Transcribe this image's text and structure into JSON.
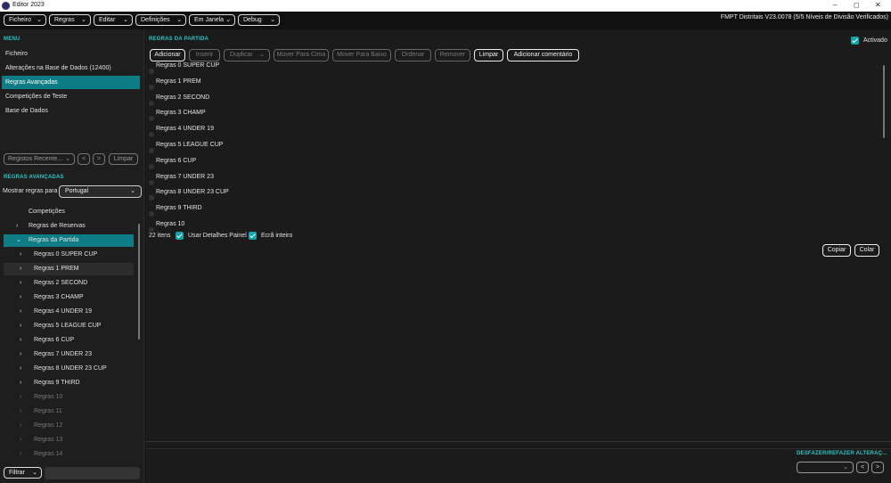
{
  "window": {
    "title": "Editor 2023",
    "minimize_glyph": "–",
    "maximize_glyph": "◻",
    "close_glyph": "✕"
  },
  "menubar": {
    "items": [
      {
        "label": "Ficheiro"
      },
      {
        "label": "Regras"
      },
      {
        "label": "Editar"
      },
      {
        "label": "Definições"
      },
      {
        "label": "Em Janela"
      },
      {
        "label": "Debug"
      }
    ],
    "version_text": "FMPT Distritais V23.0078 (5/5 Níveis de Divisão Verificados)"
  },
  "sidebar": {
    "menu_label": "MENU",
    "nav_items": [
      {
        "label": "Ficheiro"
      },
      {
        "label": "Alterações na Base de Dados (12400)"
      },
      {
        "label": "Regras Avançadas"
      },
      {
        "label": "Competições de Teste"
      },
      {
        "label": "Base de Dados"
      }
    ],
    "recent_label": "Registos Recente...",
    "back_glyph": "<",
    "forward_glyph": ">",
    "clear_label": "Limpar"
  },
  "advanced_rules": {
    "section_label": "REGRAS AVANÇADAS",
    "show_rules_for_label": "Mostrar regras para",
    "selected_country": "Portugal",
    "tree": [
      {
        "label": "Competições",
        "arrow": "",
        "indent": 1,
        "state": "normal"
      },
      {
        "label": "Regras de Reservas",
        "arrow": "›",
        "indent": 1,
        "state": "normal"
      },
      {
        "label": "Regras da Partida",
        "arrow": "⌄",
        "indent": 1,
        "state": "selected"
      },
      {
        "label": "Regras 0 SUPER CUP",
        "arrow": "›",
        "indent": 2,
        "state": "normal"
      },
      {
        "label": "Regras 1 PREM",
        "arrow": "›",
        "indent": 2,
        "state": "highlight"
      },
      {
        "label": "Regras 2 SECOND",
        "arrow": "›",
        "indent": 2,
        "state": "normal"
      },
      {
        "label": "Regras 3 CHAMP",
        "arrow": "›",
        "indent": 2,
        "state": "normal"
      },
      {
        "label": "Regras 4 UNDER 19",
        "arrow": "›",
        "indent": 2,
        "state": "normal"
      },
      {
        "label": "Regras 5 LEAGUE CUP",
        "arrow": "›",
        "indent": 2,
        "state": "normal"
      },
      {
        "label": "Regras 6 CUP",
        "arrow": "›",
        "indent": 2,
        "state": "normal"
      },
      {
        "label": "Regras 7 UNDER 23",
        "arrow": "›",
        "indent": 2,
        "state": "normal"
      },
      {
        "label": "Regras 8 UNDER 23 CUP",
        "arrow": "›",
        "indent": 2,
        "state": "normal"
      },
      {
        "label": "Regras 9 THIRD",
        "arrow": "›",
        "indent": 2,
        "state": "normal"
      },
      {
        "label": "Regras 10",
        "arrow": "›",
        "indent": 2,
        "state": "dim"
      },
      {
        "label": "Regras 11",
        "arrow": "›",
        "indent": 2,
        "state": "dim"
      },
      {
        "label": "Regras 12",
        "arrow": "›",
        "indent": 2,
        "state": "dim"
      },
      {
        "label": "Regras 13",
        "arrow": "›",
        "indent": 2,
        "state": "dim"
      },
      {
        "label": "Regras 14",
        "arrow": "›",
        "indent": 2,
        "state": "dim"
      }
    ],
    "filter_label": "Filtrar"
  },
  "main": {
    "section_label": "REGRAS DA PARTIDA",
    "activated_label": "Activado",
    "activated_checked": true,
    "toolbar": [
      {
        "label": "Adicionar",
        "enabled": true
      },
      {
        "label": "Inserir",
        "enabled": false
      },
      {
        "label": "Duplicar",
        "enabled": false,
        "chevron": true
      },
      {
        "label": "Mover Para Cima",
        "enabled": false
      },
      {
        "label": "Mover Para Baixo",
        "enabled": false
      },
      {
        "label": "Ordenar",
        "enabled": false
      },
      {
        "label": "Remover",
        "enabled": false
      },
      {
        "label": "Limpar",
        "enabled": true
      },
      {
        "label": "Adicionar comentário",
        "enabled": true
      }
    ],
    "rules": [
      "Regras 0 SUPER CUP",
      "Regras 1 PREM",
      "Regras 2 SECOND",
      "Regras 3 CHAMP",
      "Regras 4 UNDER 19",
      "Regras 5 LEAGUE CUP",
      "Regras 6 CUP",
      "Regras 7 UNDER 23",
      "Regras 8 UNDER 23 CUP",
      "Regras 9 THIRD",
      "Regras 10"
    ],
    "item_count": "22 itens",
    "use_details_panel_label": "Usar Detalhes Painel",
    "use_details_panel_checked": true,
    "fullscreen_label": "Ecrã inteiro",
    "fullscreen_checked": true,
    "copy_label": "Copiar",
    "paste_label": "Colar",
    "undo_redo_label": "DESFAZER/REFAZER ALTERAÇ...",
    "undo_glyph": "<",
    "redo_glyph": ">"
  },
  "colors": {
    "accent": "#0e7c84",
    "section_label": "#27c6c6",
    "checkbox": "#14a2ab",
    "background": "#1b1b1b"
  }
}
